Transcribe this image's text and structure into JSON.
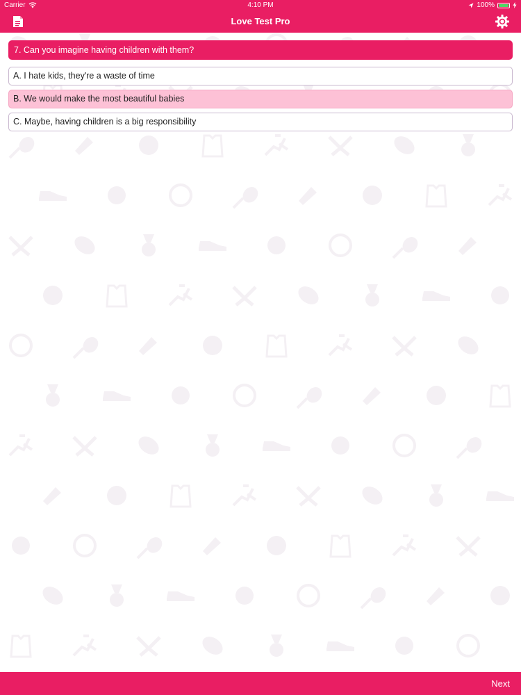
{
  "status_bar": {
    "carrier": "Carrier",
    "time": "4:10 PM",
    "battery": "100%",
    "battery_level": 1.0,
    "wifi_icon": "wifi-icon",
    "location_icon": "location-arrow-icon",
    "charging_icon": "charging-bolt-icon"
  },
  "nav": {
    "title": "Love Test Pro",
    "left_icon": "document-icon",
    "right_icon": "gear-icon"
  },
  "question": {
    "text": "7. Can you imagine having children with them?"
  },
  "options": [
    {
      "label": "A. I hate kids, they're a waste of time",
      "selected": false
    },
    {
      "label": "B. We would make the most beautiful babies",
      "selected": true
    },
    {
      "label": "C. Maybe, having children is a big responsibility",
      "selected": false
    }
  ],
  "bottom": {
    "next_label": "Next"
  },
  "colors": {
    "primary": "#e91e63",
    "selected_option": "#fdc1d6",
    "option_border": "#c9b8cf",
    "pattern": "#f4f0f4"
  },
  "background_pattern": [
    "football-icon",
    "medal-icon",
    "shoe-icon",
    "soccer-ball-icon",
    "volleyball-icon",
    "tennis-racket-icon",
    "shuttlecock-icon",
    "ball-icon",
    "jersey-icon",
    "runner-icon",
    "wrestling-icon"
  ]
}
